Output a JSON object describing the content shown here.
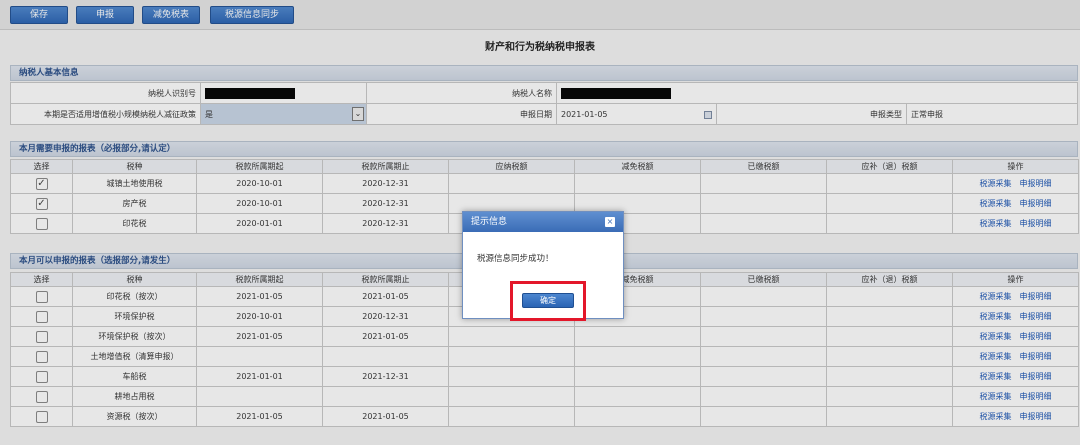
{
  "toolbar": {
    "buttons": [
      "保存",
      "申报",
      "减免税表",
      "税源信息同步"
    ]
  },
  "form_title": "财产和行为税纳税申报表",
  "taxpayer_section": {
    "heading": "纳税人基本信息",
    "taxpayer_id_label": "纳税人识别号",
    "taxpayer_name_label": "纳税人名称",
    "policy_label": "本期是否适用增值税小规模纳税人减征政策",
    "policy_value": "是",
    "declare_date_label": "申报日期",
    "declare_date_value": "2021-01-05",
    "declare_type_label": "申报类型",
    "declare_type_value": "正常申报"
  },
  "columns": [
    "选择",
    "税种",
    "税款所属期起",
    "税款所属期止",
    "应纳税额",
    "减免税额",
    "已缴税额",
    "应补（退）税额",
    "操作"
  ],
  "actions": {
    "source": "税源采集",
    "detail": "申报明细"
  },
  "required_section": {
    "heading": "本月需要申报的报表（必报部分,请认定）",
    "rows": [
      {
        "checked": "✓",
        "tax": "城镇土地使用税",
        "start": "2020-10-01",
        "end": "2020-12-31"
      },
      {
        "checked": "✓",
        "tax": "房产税",
        "start": "2020-10-01",
        "end": "2020-12-31"
      },
      {
        "checked": "",
        "tax": "印花税",
        "start": "2020-01-01",
        "end": "2020-12-31"
      }
    ]
  },
  "optional_section": {
    "heading": "本月可以申报的报表（选报部分,请发生）",
    "rows": [
      {
        "tax": "印花税（按次）",
        "start": "2021-01-05",
        "end": "2021-01-05"
      },
      {
        "tax": "环境保护税",
        "start": "2020-10-01",
        "end": "2020-12-31"
      },
      {
        "tax": "环境保护税（按次）",
        "start": "2021-01-05",
        "end": "2021-01-05"
      },
      {
        "tax": "土地增值税（清算申报）",
        "start": "",
        "end": ""
      },
      {
        "tax": "车船税",
        "start": "2021-01-01",
        "end": "2021-12-31"
      },
      {
        "tax": "耕地占用税",
        "start": "",
        "end": ""
      },
      {
        "tax": "资源税（按次）",
        "start": "2021-01-05",
        "end": "2021-01-05"
      }
    ]
  },
  "dialog": {
    "title": "提示信息",
    "close": "×",
    "message": "税源信息同步成功！",
    "ok": "确定"
  },
  "colors": {
    "accent": "#2a64b4",
    "highlight": "#e3172a"
  }
}
